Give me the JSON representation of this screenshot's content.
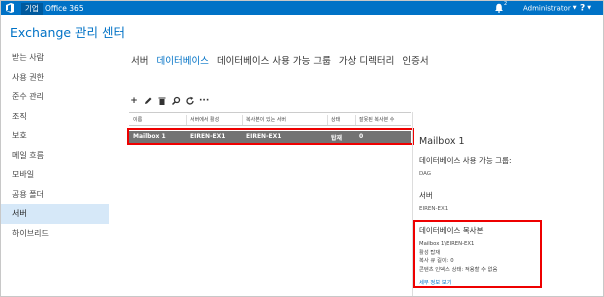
{
  "topbar": {
    "tab_company": "기업",
    "tab_office": "Office 365",
    "notification_count": "2",
    "user": "Administrator",
    "help": "?"
  },
  "app": {
    "title": "Exchange 관리 센터"
  },
  "nav": {
    "items": [
      "받는 사람",
      "사용 권한",
      "준수 관리",
      "조직",
      "보호",
      "메일 흐름",
      "모바일",
      "공용 폴더",
      "서버",
      "하이브리드"
    ],
    "active_index": 8
  },
  "tabs": [
    "서버",
    "데이터베이스",
    "데이터베이스 사용 가능 그룹",
    "가상 디렉터리",
    "인증서"
  ],
  "active_tab": 1,
  "toolbar": {
    "icons": [
      "add-icon",
      "edit-icon",
      "delete-icon",
      "search-icon",
      "refresh-icon",
      "more-icon"
    ]
  },
  "table": {
    "headers": [
      "이름",
      "서버에서 활성",
      "복사본이 있는 서버",
      "상태",
      "잘못된 복사본 수"
    ],
    "rows": [
      [
        "Mailbox 1",
        "EIREN-EX1",
        "EIREN-EX1",
        "탑재",
        "0"
      ]
    ]
  },
  "detail": {
    "title": "Mailbox 1",
    "dag_label": "데이터베이스 사용 가능 그룹:",
    "dag_value": "DAG",
    "server_label": "서버",
    "server_value": "EIREN-EX1",
    "copy_label": "데이터베이스 복사본",
    "copy_lines": [
      "Mailbox 1\\EIREN-EX1",
      "활성 탑재",
      "복사 큐 길이: 0",
      "콘텐츠 인덱스 상태: 적용할 수 없음"
    ],
    "details_link": "세부 정보 보기"
  },
  "colors": {
    "brand": "#0072c6",
    "highlight": "#e00000",
    "selected_row": "#737373",
    "nav_active": "#d6e8f8"
  }
}
